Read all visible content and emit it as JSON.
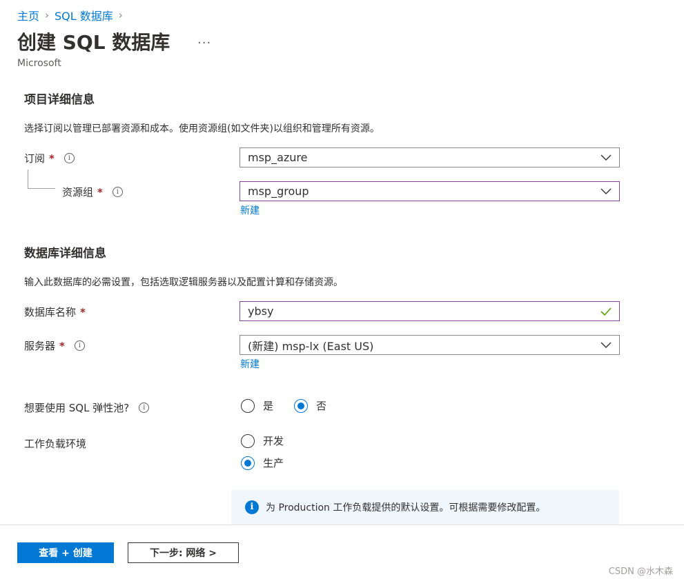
{
  "breadcrumb": {
    "home": "主页",
    "sep1": "›",
    "db": "SQL 数据库",
    "sep2": "›"
  },
  "header": {
    "title": "创建 SQL 数据库",
    "more": "···",
    "publisher": "Microsoft"
  },
  "project": {
    "heading": "项目详细信息",
    "description": "选择订阅以管理已部署资源和成本。使用资源组(如文件夹)以组织和管理所有资源。",
    "subscription": {
      "label": "订阅",
      "required": "*",
      "value": "msp_azure"
    },
    "resource_group": {
      "label": "资源组",
      "required": "*",
      "value": "msp_group",
      "new_link": "新建"
    }
  },
  "database": {
    "heading": "数据库详细信息",
    "description": "输入此数据库的必需设置，包括选取逻辑服务器以及配置计算和存储资源。",
    "name": {
      "label": "数据库名称",
      "required": "*",
      "value": "ybsy"
    },
    "server": {
      "label": "服务器",
      "required": "*",
      "value": "(新建) msp-lx (East US)",
      "new_link": "新建"
    },
    "elastic_pool": {
      "label": "想要使用 SQL 弹性池?",
      "yes": "是",
      "no": "否",
      "selected": "否"
    },
    "workload": {
      "label": "工作负载环境",
      "dev": "开发",
      "prod": "生产",
      "selected": "生产"
    },
    "note": "为 Production 工作负载提供的默认设置。可根据需要修改配置。"
  },
  "footer": {
    "review_create": "查看 + 创建",
    "next": "下一步: 网络 >"
  },
  "watermark": "CSDN @水木森",
  "icons": {
    "info": "info-icon",
    "chevron": "chevron-down-icon",
    "check": "check-icon"
  },
  "colors": {
    "accent": "#0078d4",
    "required": "#a4262c",
    "focus_border": "#8a3f9e",
    "valid": "#57a300"
  }
}
